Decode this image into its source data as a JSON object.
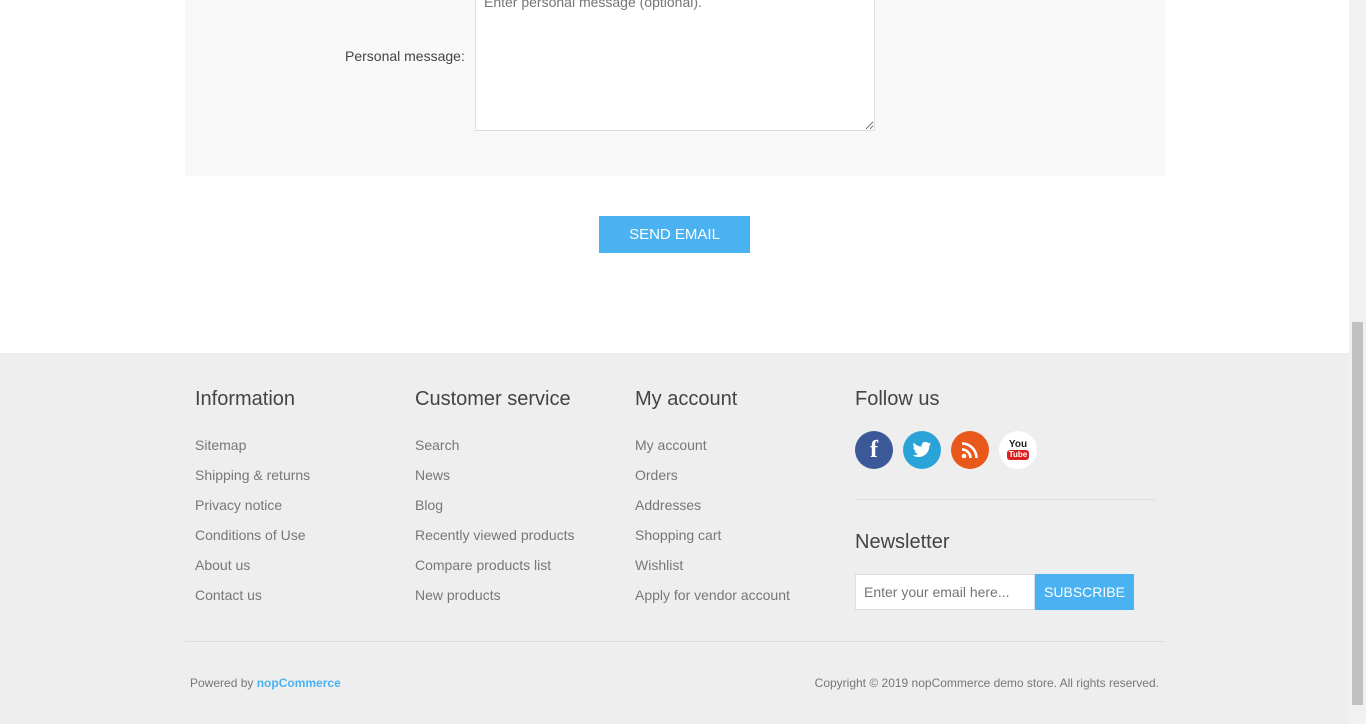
{
  "form": {
    "personal_message_label": "Personal message:",
    "personal_message_placeholder": "Enter personal message (optional)."
  },
  "send_button": "SEND EMAIL",
  "footer": {
    "information": {
      "title": "Information",
      "links": [
        "Sitemap",
        "Shipping & returns",
        "Privacy notice",
        "Conditions of Use",
        "About us",
        "Contact us"
      ]
    },
    "customer_service": {
      "title": "Customer service",
      "links": [
        "Search",
        "News",
        "Blog",
        "Recently viewed products",
        "Compare products list",
        "New products"
      ]
    },
    "my_account": {
      "title": "My account",
      "links": [
        "My account",
        "Orders",
        "Addresses",
        "Shopping cart",
        "Wishlist",
        "Apply for vendor account"
      ]
    },
    "follow_us": {
      "title": "Follow us",
      "icons": [
        "facebook-icon",
        "twitter-icon",
        "rss-icon",
        "youtube-icon"
      ],
      "youtube_you": "You",
      "youtube_tube": "Tube"
    },
    "newsletter": {
      "title": "Newsletter",
      "placeholder": "Enter your email here...",
      "button": "SUBSCRIBE"
    },
    "powered_by_prefix": "Powered by",
    "powered_by_link": "nopCommerce",
    "copyright": "Copyright © 2019 nopCommerce demo store. All rights reserved."
  },
  "colors": {
    "accent": "#4ab2f1",
    "facebook": "#3b5998",
    "twitter": "#2aa3d8",
    "rss": "#e9581b",
    "footer_bg": "#eeeeee"
  }
}
